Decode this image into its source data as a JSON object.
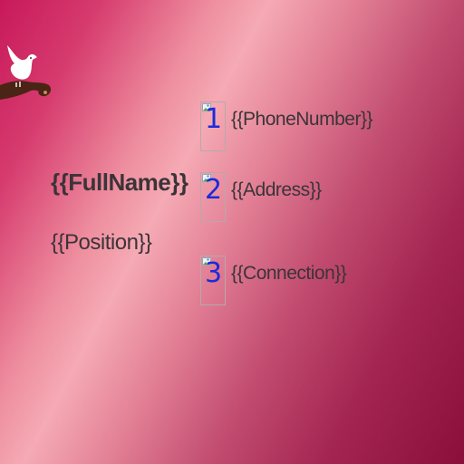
{
  "card": {
    "full_name": "{{FullName}}",
    "position": "{{Position}}"
  },
  "contacts": [
    {
      "icon_text": "1",
      "icon": "image-placeholder-icon",
      "value": "{{PhoneNumber}}"
    },
    {
      "icon_text": "2",
      "icon": "image-placeholder-icon",
      "value": "{{Address}}"
    },
    {
      "icon_text": "3",
      "icon": "image-placeholder-icon",
      "value": "{{Connection}}"
    }
  ],
  "colors": {
    "background_start": "#c8195a",
    "background_mid": "#f5aab4",
    "background_end": "#8b0d3a",
    "text": "#3b3438",
    "number": "#1c2ad9"
  }
}
